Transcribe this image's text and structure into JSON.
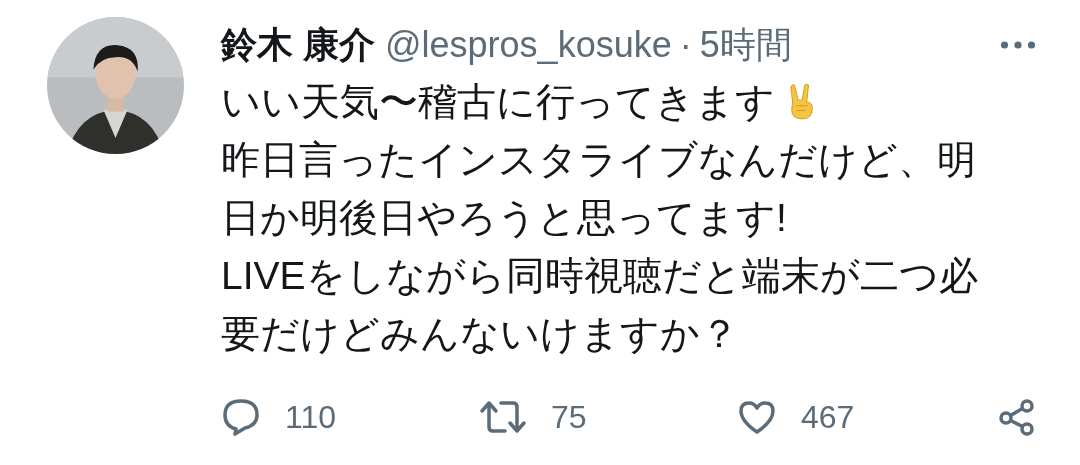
{
  "tweet": {
    "author_name": "鈴木 康介",
    "handle": "@lespros_kosuke",
    "separator": "·",
    "time": "5時間",
    "lines": [
      "いい天気〜稽古に行ってきます",
      "昨日言ったインスタライブなんだけど、明",
      "日か明後日やろうと思ってます!",
      "LIVEをしながら同時視聴だと端末が二つ必",
      "要だけどみんないけますか？"
    ],
    "actions": [
      {
        "kind": "reply",
        "count": "110"
      },
      {
        "kind": "retweet",
        "count": "75"
      },
      {
        "kind": "like",
        "count": "467"
      },
      {
        "kind": "share"
      }
    ]
  }
}
